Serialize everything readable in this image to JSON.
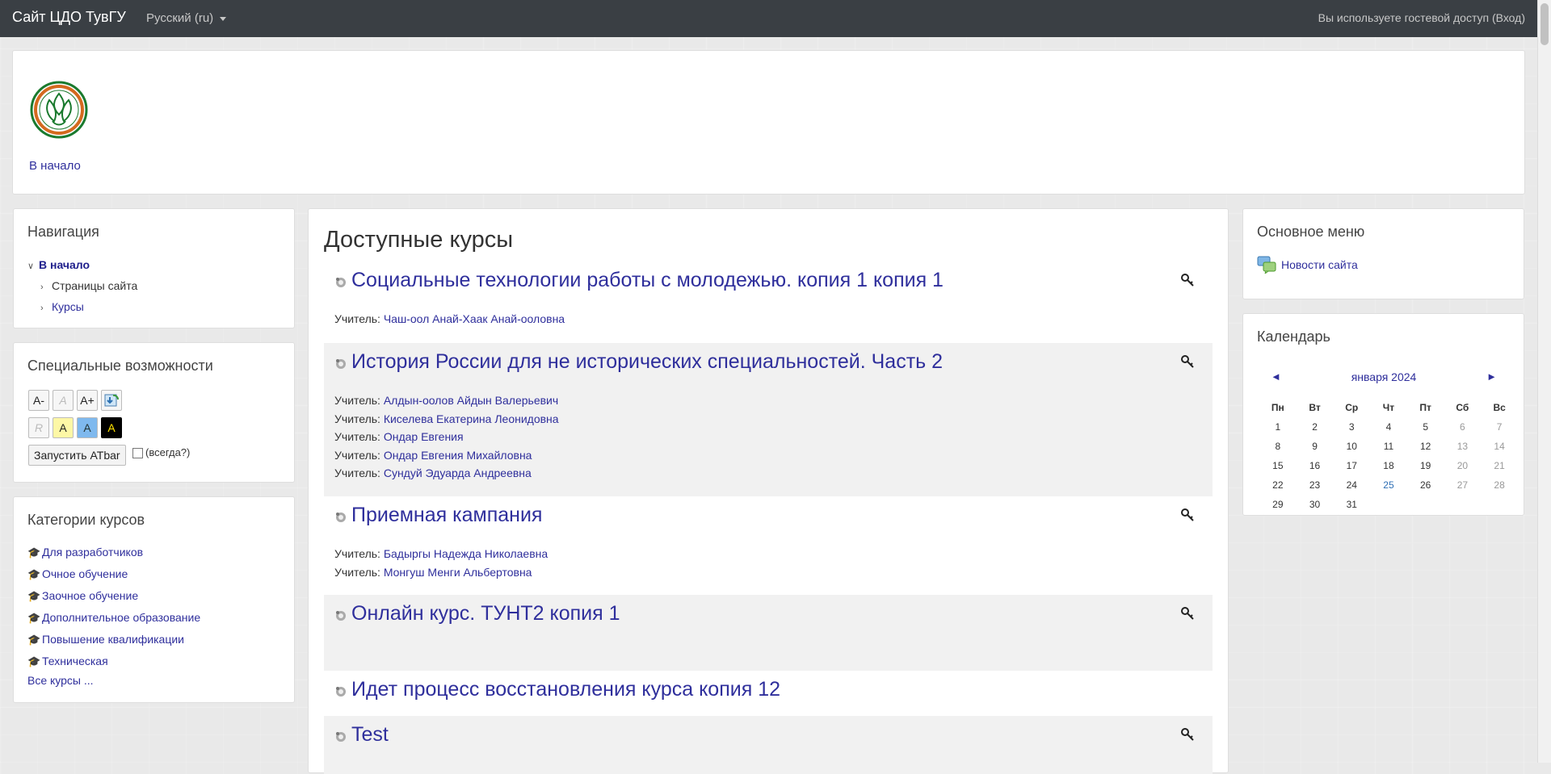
{
  "navbar": {
    "brand": "Сайт ЦДО ТувГУ",
    "language": "Русский (ru)",
    "login_text": "Вы используете гостевой доступ (Вход)"
  },
  "header": {
    "home_link": "В начало"
  },
  "navigation": {
    "title": "Навигация",
    "home": "В начало",
    "items": [
      "Страницы сайта",
      "Курсы"
    ]
  },
  "accessibility": {
    "title": "Специальные возможности",
    "buttons_row1": [
      "A-",
      "A",
      "A+"
    ],
    "buttons_row2": [
      "R",
      "A",
      "A",
      "A"
    ],
    "atbar_button": "Запустить ATbar",
    "always_label": "(всегда?)"
  },
  "categories": {
    "title": "Категории курсов",
    "items": [
      "Для разработчиков",
      "Очное обучение",
      "Заочное обучение",
      "Дополнительное образование",
      "Повышение квалификации",
      "Техническая"
    ],
    "all_courses": "Все курсы ..."
  },
  "main": {
    "title": "Доступные курсы",
    "teacher_label": "Учитель:",
    "courses": [
      {
        "name": "Социальные технологии работы с молодежью. копия 1 копия 1",
        "teachers": [
          "Чаш-оол Анай-Хаак Анай-ооловна"
        ]
      },
      {
        "name": "История России для не исторических специальностей. Часть 2",
        "teachers": [
          "Алдын-оолов Айдын Валерьевич",
          "Киселева Екатерина Леонидовна",
          "Ондар Евгения",
          "Ондар Евгения Михайловна",
          "Сундуй Эдуарда Андреевна"
        ]
      },
      {
        "name": "Приемная кампания",
        "teachers": [
          "Бадыргы Надежда Николаевна",
          "Монгуш Менги Альбертовна"
        ]
      },
      {
        "name": "Онлайн курс. ТУНТ2 копия 1",
        "teachers": []
      },
      {
        "name": "Идет процесс восстановления курса копия 12",
        "teachers": []
      },
      {
        "name": "Test",
        "teachers": []
      }
    ]
  },
  "main_menu": {
    "title": "Основное меню",
    "item": "Новости сайта"
  },
  "calendar": {
    "title": "Календарь",
    "prev": "◄",
    "next": "►",
    "month": "января 2024",
    "weekdays": [
      "Пн",
      "Вт",
      "Ср",
      "Чт",
      "Пт",
      "Сб",
      "Вс"
    ],
    "weeks": [
      [
        "1",
        "2",
        "3",
        "4",
        "5",
        "6",
        "7"
      ],
      [
        "8",
        "9",
        "10",
        "11",
        "12",
        "13",
        "14"
      ],
      [
        "15",
        "16",
        "17",
        "18",
        "19",
        "20",
        "21"
      ],
      [
        "22",
        "23",
        "24",
        "25",
        "26",
        "27",
        "28"
      ],
      [
        "29",
        "30",
        "31",
        "",
        "",
        "",
        ""
      ]
    ],
    "today": "25"
  }
}
